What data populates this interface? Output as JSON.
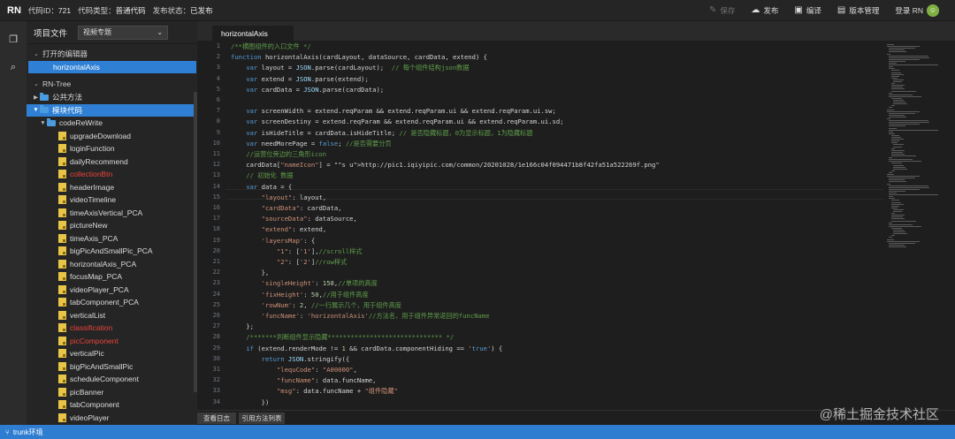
{
  "topbar": {
    "app": "RN",
    "code_id_label": "代码ID：",
    "code_id": "721",
    "code_type_label": "代码类型：",
    "code_type": "普通代码",
    "publish_label": "发布状态：",
    "publish_status": "已发布",
    "buttons": {
      "save": "保存",
      "publish": "发布",
      "compile": "编译",
      "version": "版本管理"
    },
    "login": "登录 RN"
  },
  "sidebar": {
    "title": "项目文件",
    "dropdown": "视频专题",
    "open_editors": "打开的编辑器",
    "open_file": "horizontalAxis",
    "root": "RN-Tree",
    "tree": [
      {
        "label": "公共方法",
        "type": "folder",
        "state": "collapsed"
      },
      {
        "label": "模块代码",
        "type": "folder",
        "state": "expanded"
      },
      {
        "label": "codeReWrite",
        "type": "folder",
        "state": "expanded"
      }
    ],
    "files": [
      {
        "label": "upgradeDownload",
        "red": false
      },
      {
        "label": "loginFunction",
        "red": false
      },
      {
        "label": "dailyRecommend",
        "red": false
      },
      {
        "label": "collectionBtn",
        "red": true
      },
      {
        "label": "headerImage",
        "red": false
      },
      {
        "label": "videoTimeline",
        "red": false
      },
      {
        "label": "timeAxisVertical_PCA",
        "red": false
      },
      {
        "label": "pictureNew",
        "red": false
      },
      {
        "label": "timeAxis_PCA",
        "red": false
      },
      {
        "label": "bigPicAndSmallPic_PCA",
        "red": false
      },
      {
        "label": "horizontalAxis_PCA",
        "red": false
      },
      {
        "label": "focusMap_PCA",
        "red": false
      },
      {
        "label": "videoPlayer_PCA",
        "red": false
      },
      {
        "label": "tabComponent_PCA",
        "red": false
      },
      {
        "label": "verticalList",
        "red": false
      },
      {
        "label": "classification",
        "red": true
      },
      {
        "label": "picComponent",
        "red": true
      },
      {
        "label": "verticalPic",
        "red": false
      },
      {
        "label": "bigPicAndSmallPic",
        "red": false
      },
      {
        "label": "scheduleComponent",
        "red": false
      },
      {
        "label": "picBanner",
        "red": false
      },
      {
        "label": "tabComponent",
        "red": false
      },
      {
        "label": "videoPlayer",
        "red": false
      }
    ]
  },
  "editor": {
    "tab": "horizontalAxis",
    "line_numbers": [
      "1",
      "2",
      "3",
      "4",
      "5",
      "6",
      "7",
      "8",
      "9",
      "10",
      "11",
      "12",
      "13",
      "14",
      "15",
      "16",
      "17",
      "18",
      "19",
      "20",
      "21",
      "22",
      "23",
      "24",
      "25",
      "26",
      "27",
      "28",
      "29",
      "30",
      "31",
      "32",
      "33",
      "34"
    ],
    "lines": [
      "/**横图组件的入口文件 */",
      "function horizontalAxis(cardLayout, dataSource, cardData, extend) {",
      "    var layout = JSON.parse(cardLayout);  // 每个组件结构json数据",
      "    var extend = JSON.parse(extend);",
      "    var cardData = JSON.parse(cardData);",
      "",
      "    var screenWidth = extend.reqParam && extend.reqParam.ui && extend.reqParam.ui.sw;",
      "    var screenDestiny = extend.reqParam && extend.reqParam.ui && extend.reqParam.ui.sd;",
      "    var isHideTitle = cardData.isHideTitle; // 是否隐藏标题，0为显示标题，1为隐藏标题",
      "    var needMorePage = false; //是否需要分页",
      "    //运营位旁边的三角形icon",
      "    cardData[\"nameIcon\"] = \"http://pic1.iqiyipic.com/common/20201028/1e166c04f094471b8f42fa51a522269f.png\"",
      "    // 初始化 数据",
      "    var data = {",
      "        \"layout\": layout,",
      "        \"cardData\": cardData,",
      "        \"sourceData\": dataSource,",
      "        \"extend\": extend,",
      "        'layersMap': {",
      "            \"1\": ['1'],//scroll样式",
      "            \"2\": ['2']//row样式",
      "        },",
      "        'singleHeight': 158,//单项的高度",
      "        'fixHeight': 50,//用于组件高度",
      "        'rowNum': 2, //一行展示几个，用于组件高度",
      "        'funcName': 'horizontalAxis'//方法名，用于组件异常返回的funcName",
      "    };",
      "    /*******判断组件显示隐藏****************************** */",
      "    if (extend.renderMode != 1 && cardData.componentHiding == 'true') {",
      "        return JSON.stringify({",
      "            \"lequCode\": \"A00000\",",
      "            \"funcName\": data.funcName,",
      "            \"msg\": data.funcName + \"组件隐藏\"",
      "        })",
      "    }"
    ]
  },
  "bottom": {
    "tab1": "查看日志",
    "tab2": "引用方法列表"
  },
  "status": {
    "branch": "trunk环境"
  },
  "watermark": "@稀土掘金技术社区"
}
